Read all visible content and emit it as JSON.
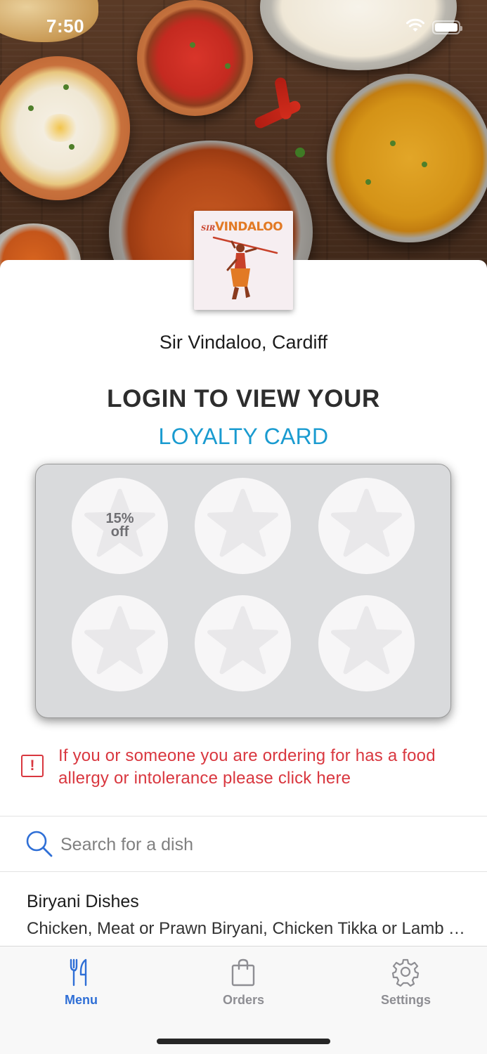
{
  "status_bar": {
    "time": "7:50",
    "wifi_icon": "wifi-icon",
    "battery_icon": "battery-icon"
  },
  "header": {
    "hero_image": "indian-food-dishes-photo",
    "logo": {
      "icon": "sir-vindaloo-logo",
      "text_small": "SIR",
      "text_main": "VINDALOO",
      "colors": {
        "small": "#c8412a",
        "main": "#e27a25"
      }
    },
    "restaurant_name": "Sir Vindaloo, Cardiff"
  },
  "loyalty": {
    "heading": "LOGIN TO VIEW YOUR",
    "subheading": "LOYALTY CARD",
    "stamps": [
      {
        "label_line1": "15%",
        "label_line2": "off",
        "icon": "star-icon"
      },
      {
        "label_line1": "",
        "label_line2": "",
        "icon": "star-icon"
      },
      {
        "label_line1": "",
        "label_line2": "",
        "icon": "star-icon"
      },
      {
        "label_line1": "",
        "label_line2": "",
        "icon": "star-icon"
      },
      {
        "label_line1": "",
        "label_line2": "",
        "icon": "star-icon"
      },
      {
        "label_line1": "",
        "label_line2": "",
        "icon": "star-icon"
      }
    ]
  },
  "allergy_notice": {
    "icon": "alert-icon",
    "text": "If you or someone you are ordering for has a food allergy or intolerance please click here"
  },
  "search": {
    "icon": "search-icon",
    "placeholder": "Search for a dish",
    "value": ""
  },
  "menu_categories": [
    {
      "title": "Biryani Dishes",
      "description": "Chicken, Meat or Prawn Biryani, Chicken Tikka or Lamb Tikka Biryani"
    }
  ],
  "tab_bar": {
    "tabs": [
      {
        "label": "Menu",
        "icon": "fork-knife-icon",
        "active": true
      },
      {
        "label": "Orders",
        "icon": "shopping-bag-icon",
        "active": false
      },
      {
        "label": "Settings",
        "icon": "gear-icon",
        "active": false
      }
    ]
  },
  "colors": {
    "accent_blue": "#1a9bd0",
    "tab_active": "#2f6fd6",
    "tab_inactive": "#8e8e93",
    "alert_red": "#d9373f",
    "card_background": "#d9dadc",
    "stamp_background": "#f7f6f7"
  }
}
